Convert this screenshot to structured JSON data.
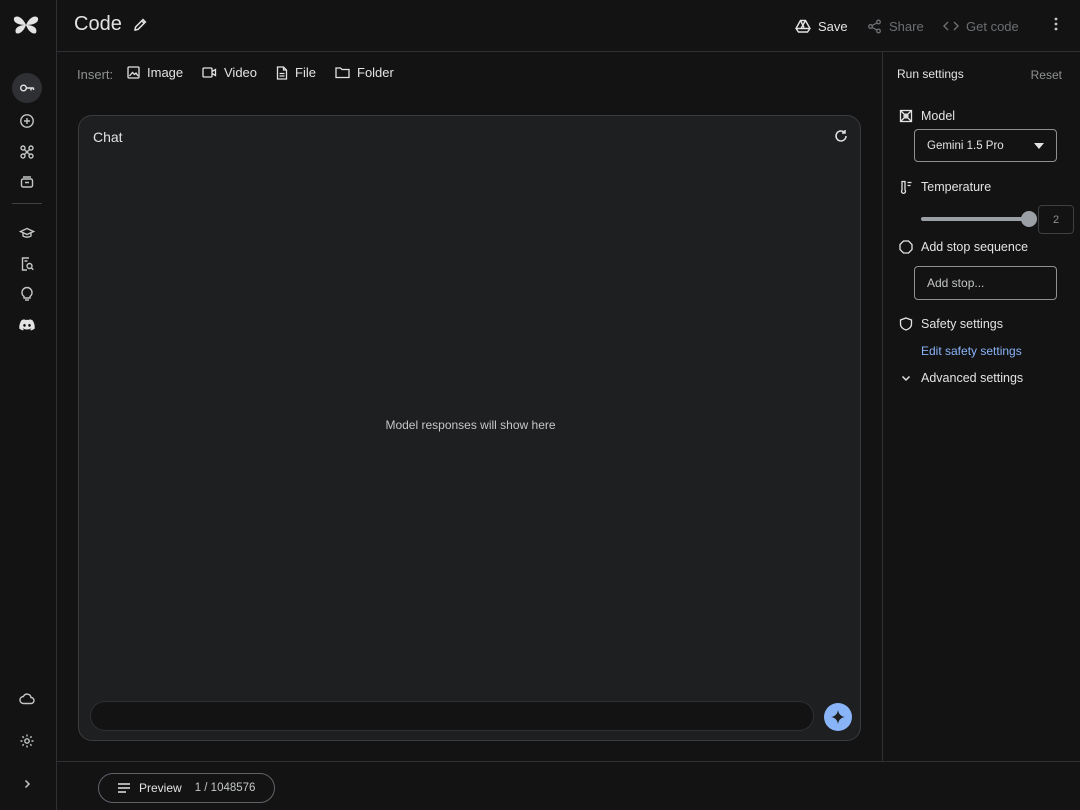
{
  "header": {
    "title": "Code",
    "save_label": "Save",
    "share_label": "Share",
    "getcode_label": "Get code"
  },
  "insert": {
    "label": "Insert:",
    "image": "Image",
    "video": "Video",
    "file": "File",
    "folder": "Folder"
  },
  "chat": {
    "title": "Chat",
    "empty_text": "Model responses will show here",
    "prompt_value": ""
  },
  "settings": {
    "title": "Run settings",
    "reset": "Reset",
    "model_label": "Model",
    "model_value": "Gemini 1.5 Pro",
    "temperature_label": "Temperature",
    "temperature_value": "2",
    "temperature_fraction": 1.0,
    "stop_label": "Add stop sequence",
    "stop_placeholder": "Add stop...",
    "safety_label": "Safety settings",
    "safety_link": "Edit safety settings",
    "advanced_label": "Advanced settings"
  },
  "footer": {
    "preview_label": "Preview",
    "token_count": "1 / 1048576"
  },
  "colors": {
    "background": "#131314",
    "panel": "#1e1f20",
    "accent": "#8ab4f8"
  }
}
